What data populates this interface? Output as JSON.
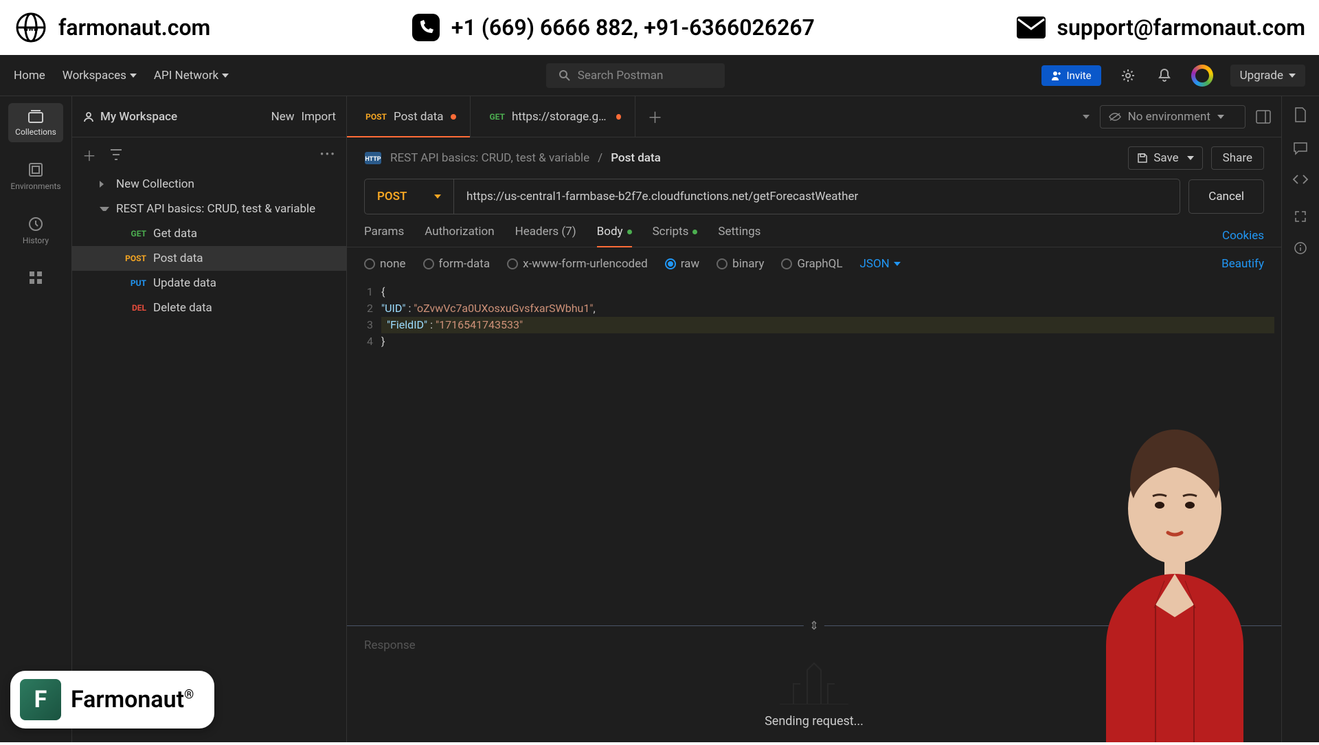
{
  "top_header": {
    "site": "farmonaut.com",
    "phone": "+1 (669) 6666 882, +91-6366026267",
    "email": "support@farmonaut.com"
  },
  "nav": {
    "home": "Home",
    "workspaces": "Workspaces",
    "api_network": "API Network",
    "search_placeholder": "Search Postman",
    "invite": "Invite",
    "upgrade": "Upgrade"
  },
  "left_rail": {
    "collections": "Collections",
    "environments": "Environments",
    "history": "History"
  },
  "sidebar": {
    "workspace": "My Workspace",
    "new": "New",
    "import": "Import",
    "collections": [
      {
        "name": "New Collection"
      },
      {
        "name": "REST API basics: CRUD, test & variable"
      }
    ],
    "requests": [
      {
        "method": "GET",
        "name": "Get data",
        "cls": "m-get"
      },
      {
        "method": "POST",
        "name": "Post data",
        "cls": "m-post"
      },
      {
        "method": "PUT",
        "name": "Update data",
        "cls": "m-put"
      },
      {
        "method": "DEL",
        "name": "Delete data",
        "cls": "m-del"
      }
    ]
  },
  "tabs": [
    {
      "method": "POST",
      "label": "Post data",
      "cls": "m-post",
      "active": true
    },
    {
      "method": "GET",
      "label": "https://storage.googlea",
      "cls": "m-get",
      "active": false
    }
  ],
  "env": {
    "label": "No environment"
  },
  "breadcrumb": {
    "parent": "REST API basics: CRUD, test & variable",
    "sep": "/",
    "current": "Post data"
  },
  "actions": {
    "save": "Save",
    "share": "Share",
    "cancel": "Cancel"
  },
  "request": {
    "method": "POST",
    "url": "https://us-central1-farmbase-b2f7e.cloudfunctions.net/getForecastWeather"
  },
  "req_tabs": {
    "params": "Params",
    "auth": "Authorization",
    "headers": "Headers (7)",
    "body": "Body",
    "scripts": "Scripts",
    "settings": "Settings",
    "cookies": "Cookies"
  },
  "body_types": {
    "none": "none",
    "form": "form-data",
    "urlenc": "x-www-form-urlencoded",
    "raw": "raw",
    "binary": "binary",
    "graphql": "GraphQL",
    "json": "JSON",
    "beautify": "Beautify"
  },
  "editor": {
    "lines": [
      "1",
      "2",
      "3",
      "4"
    ],
    "l1": "{",
    "l2_key": "\"UID\"",
    "l2_sep": " : ",
    "l2_val": "\"oZvwVc7a0UXosxuGvsfxarSWbhu1\"",
    "l2_end": ",",
    "l3_indent": "  ",
    "l3_key": "\"FieldID\"",
    "l3_sep": " : ",
    "l3_val": "\"1716541743533\"",
    "l4": "}"
  },
  "response": {
    "label": "Response",
    "status": "Sending request..."
  },
  "brand": {
    "name": "Farmonaut",
    "reg": "®"
  }
}
